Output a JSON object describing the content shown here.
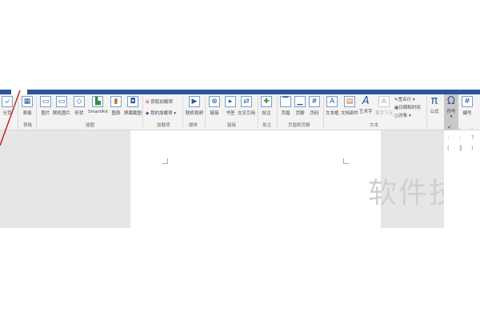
{
  "ribbon": {
    "buttons": {
      "pagebreak": "分页",
      "table": "表格",
      "picture": "图片",
      "online_picture": "联机图片",
      "shapes": "形状",
      "smartart": "SmartArt",
      "chart": "图表",
      "screenshot": "屏幕截图",
      "get_addins": "获取加载项",
      "my_addins": "我的加载项",
      "online_video": "联机视频",
      "link": "链接",
      "bookmark": "书签",
      "cross_ref": "交叉引用",
      "comment": "批注",
      "header": "页眉",
      "footer": "页脚",
      "page_number": "页码",
      "textbox": "文本框",
      "quick_parts": "文档部件",
      "wordart": "艺术字",
      "dropcap": "首字下沉",
      "signature": "签名行",
      "datetime": "日期和时间",
      "object": "对象",
      "equation": "公式",
      "symbol": "符号",
      "number": "编号"
    },
    "groups": {
      "tables": "表格",
      "illustrations": "插图",
      "addins": "加载项",
      "media": "媒体",
      "links": "链接",
      "comments": "批注",
      "header_footer": "页眉和页脚",
      "text": "文本"
    }
  },
  "symbols": [
    "✓",
    ",",
    ".",
    ":",
    ";",
    "?",
    "(",
    "‖",
    ")"
  ],
  "watermark": "软件技"
}
